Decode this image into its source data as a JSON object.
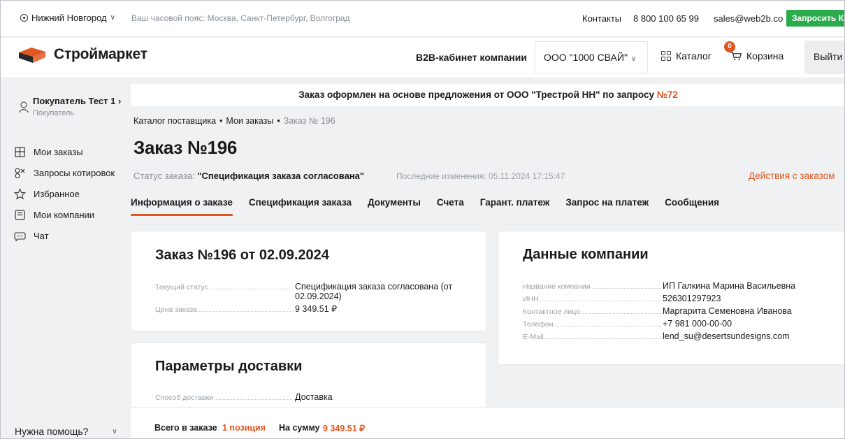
{
  "topbar": {
    "city": "Нижний Новгород",
    "timezone": "Ваш часовой пояс: Москва, Санкт-Петербург, Волгоград",
    "contacts": "Контакты",
    "phone": "8 800 100 65 99",
    "email": "sales@web2b.co",
    "request_kp": "Запросить КП"
  },
  "header": {
    "logo_text": "Строймаркет",
    "b2b": "B2B-кабинет компании",
    "company": "ООО \"1000 СВАЙ\"",
    "catalog": "Каталог",
    "cart": "Корзина",
    "cart_count": "0",
    "exit": "Выйти"
  },
  "sidebar": {
    "user_name": "Покупатель Тест 1",
    "user_arrow": "›",
    "user_role": "Покупатель",
    "items": [
      {
        "label": "Мои заказы",
        "icon": "orders-icon"
      },
      {
        "label": "Запросы котировок",
        "icon": "quotes-icon"
      },
      {
        "label": "Избранное",
        "icon": "star-icon"
      },
      {
        "label": "Мои компании",
        "icon": "company-icon"
      },
      {
        "label": "Чат",
        "icon": "chat-icon"
      }
    ],
    "help": "Нужна помощь?"
  },
  "main": {
    "notice_text": "Заказ оформлен на основе предложения от ООО \"Трестрой НН\" по запросу ",
    "notice_num": "№72",
    "breadcrumb": [
      "Каталог поставщика",
      "Мои заказы",
      "Заказ № 196"
    ],
    "title": "Заказ №196",
    "status_label": "Статус заказа: ",
    "status_value": "\"Спецификация заказа согласована\"",
    "last_change": "Последние изменения: 05.11.2024 17:15:47",
    "actions": "Действия с заказом",
    "tabs": [
      "Информация о заказе",
      "Спецификация заказа",
      "Документы",
      "Счета",
      "Гарант. платеж",
      "Запрос на платеж",
      "Сообщения"
    ]
  },
  "order_card": {
    "title": "Заказ №196 от 02.09.2024",
    "rows": [
      {
        "label": "Текущий статус",
        "value": "Спецификация заказа согласована (от 02.09.2024)"
      },
      {
        "label": "Цена заказа",
        "value": "9 349.51 ₽"
      }
    ]
  },
  "company_card": {
    "title": "Данные компании",
    "rows": [
      {
        "label": "Название компании",
        "value": "ИП Галкина Марина Васильевна"
      },
      {
        "label": "ИНН",
        "value": "526301297923"
      },
      {
        "label": "Контактное лицо",
        "value": "Маргарита Семеновна Иванова"
      },
      {
        "label": "Телефон",
        "value": "+7 981 000-00-00"
      },
      {
        "label": "E-Mail",
        "value": "lend_su@desertsundesigns.com"
      }
    ]
  },
  "delivery_card": {
    "title": "Параметры доставки",
    "rows": [
      {
        "label": "Способ доставки",
        "value": "Доставка"
      }
    ]
  },
  "summary": {
    "total_label": "Всего в заказе",
    "total_value": "1 позиция",
    "sum_label": "На сумму",
    "sum_value": "9 349.51 ₽"
  },
  "colors": {
    "accent": "#e0561f",
    "green": "#2bab4c"
  }
}
